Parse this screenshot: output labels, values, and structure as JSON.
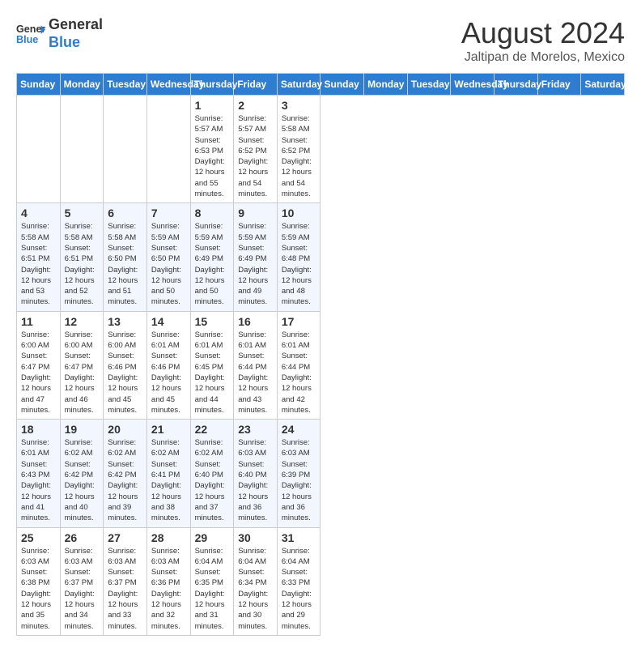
{
  "header": {
    "logo_line1": "General",
    "logo_line2": "Blue",
    "month": "August 2024",
    "location": "Jaltipan de Morelos, Mexico"
  },
  "weekdays": [
    "Sunday",
    "Monday",
    "Tuesday",
    "Wednesday",
    "Thursday",
    "Friday",
    "Saturday"
  ],
  "weeks": [
    [
      {
        "day": "",
        "info": ""
      },
      {
        "day": "",
        "info": ""
      },
      {
        "day": "",
        "info": ""
      },
      {
        "day": "",
        "info": ""
      },
      {
        "day": "1",
        "info": "Sunrise: 5:57 AM\nSunset: 6:53 PM\nDaylight: 12 hours\nand 55 minutes."
      },
      {
        "day": "2",
        "info": "Sunrise: 5:57 AM\nSunset: 6:52 PM\nDaylight: 12 hours\nand 54 minutes."
      },
      {
        "day": "3",
        "info": "Sunrise: 5:58 AM\nSunset: 6:52 PM\nDaylight: 12 hours\nand 54 minutes."
      }
    ],
    [
      {
        "day": "4",
        "info": "Sunrise: 5:58 AM\nSunset: 6:51 PM\nDaylight: 12 hours\nand 53 minutes."
      },
      {
        "day": "5",
        "info": "Sunrise: 5:58 AM\nSunset: 6:51 PM\nDaylight: 12 hours\nand 52 minutes."
      },
      {
        "day": "6",
        "info": "Sunrise: 5:58 AM\nSunset: 6:50 PM\nDaylight: 12 hours\nand 51 minutes."
      },
      {
        "day": "7",
        "info": "Sunrise: 5:59 AM\nSunset: 6:50 PM\nDaylight: 12 hours\nand 50 minutes."
      },
      {
        "day": "8",
        "info": "Sunrise: 5:59 AM\nSunset: 6:49 PM\nDaylight: 12 hours\nand 50 minutes."
      },
      {
        "day": "9",
        "info": "Sunrise: 5:59 AM\nSunset: 6:49 PM\nDaylight: 12 hours\nand 49 minutes."
      },
      {
        "day": "10",
        "info": "Sunrise: 5:59 AM\nSunset: 6:48 PM\nDaylight: 12 hours\nand 48 minutes."
      }
    ],
    [
      {
        "day": "11",
        "info": "Sunrise: 6:00 AM\nSunset: 6:47 PM\nDaylight: 12 hours\nand 47 minutes."
      },
      {
        "day": "12",
        "info": "Sunrise: 6:00 AM\nSunset: 6:47 PM\nDaylight: 12 hours\nand 46 minutes."
      },
      {
        "day": "13",
        "info": "Sunrise: 6:00 AM\nSunset: 6:46 PM\nDaylight: 12 hours\nand 45 minutes."
      },
      {
        "day": "14",
        "info": "Sunrise: 6:01 AM\nSunset: 6:46 PM\nDaylight: 12 hours\nand 45 minutes."
      },
      {
        "day": "15",
        "info": "Sunrise: 6:01 AM\nSunset: 6:45 PM\nDaylight: 12 hours\nand 44 minutes."
      },
      {
        "day": "16",
        "info": "Sunrise: 6:01 AM\nSunset: 6:44 PM\nDaylight: 12 hours\nand 43 minutes."
      },
      {
        "day": "17",
        "info": "Sunrise: 6:01 AM\nSunset: 6:44 PM\nDaylight: 12 hours\nand 42 minutes."
      }
    ],
    [
      {
        "day": "18",
        "info": "Sunrise: 6:01 AM\nSunset: 6:43 PM\nDaylight: 12 hours\nand 41 minutes."
      },
      {
        "day": "19",
        "info": "Sunrise: 6:02 AM\nSunset: 6:42 PM\nDaylight: 12 hours\nand 40 minutes."
      },
      {
        "day": "20",
        "info": "Sunrise: 6:02 AM\nSunset: 6:42 PM\nDaylight: 12 hours\nand 39 minutes."
      },
      {
        "day": "21",
        "info": "Sunrise: 6:02 AM\nSunset: 6:41 PM\nDaylight: 12 hours\nand 38 minutes."
      },
      {
        "day": "22",
        "info": "Sunrise: 6:02 AM\nSunset: 6:40 PM\nDaylight: 12 hours\nand 37 minutes."
      },
      {
        "day": "23",
        "info": "Sunrise: 6:03 AM\nSunset: 6:40 PM\nDaylight: 12 hours\nand 36 minutes."
      },
      {
        "day": "24",
        "info": "Sunrise: 6:03 AM\nSunset: 6:39 PM\nDaylight: 12 hours\nand 36 minutes."
      }
    ],
    [
      {
        "day": "25",
        "info": "Sunrise: 6:03 AM\nSunset: 6:38 PM\nDaylight: 12 hours\nand 35 minutes."
      },
      {
        "day": "26",
        "info": "Sunrise: 6:03 AM\nSunset: 6:37 PM\nDaylight: 12 hours\nand 34 minutes."
      },
      {
        "day": "27",
        "info": "Sunrise: 6:03 AM\nSunset: 6:37 PM\nDaylight: 12 hours\nand 33 minutes."
      },
      {
        "day": "28",
        "info": "Sunrise: 6:03 AM\nSunset: 6:36 PM\nDaylight: 12 hours\nand 32 minutes."
      },
      {
        "day": "29",
        "info": "Sunrise: 6:04 AM\nSunset: 6:35 PM\nDaylight: 12 hours\nand 31 minutes."
      },
      {
        "day": "30",
        "info": "Sunrise: 6:04 AM\nSunset: 6:34 PM\nDaylight: 12 hours\nand 30 minutes."
      },
      {
        "day": "31",
        "info": "Sunrise: 6:04 AM\nSunset: 6:33 PM\nDaylight: 12 hours\nand 29 minutes."
      }
    ]
  ]
}
